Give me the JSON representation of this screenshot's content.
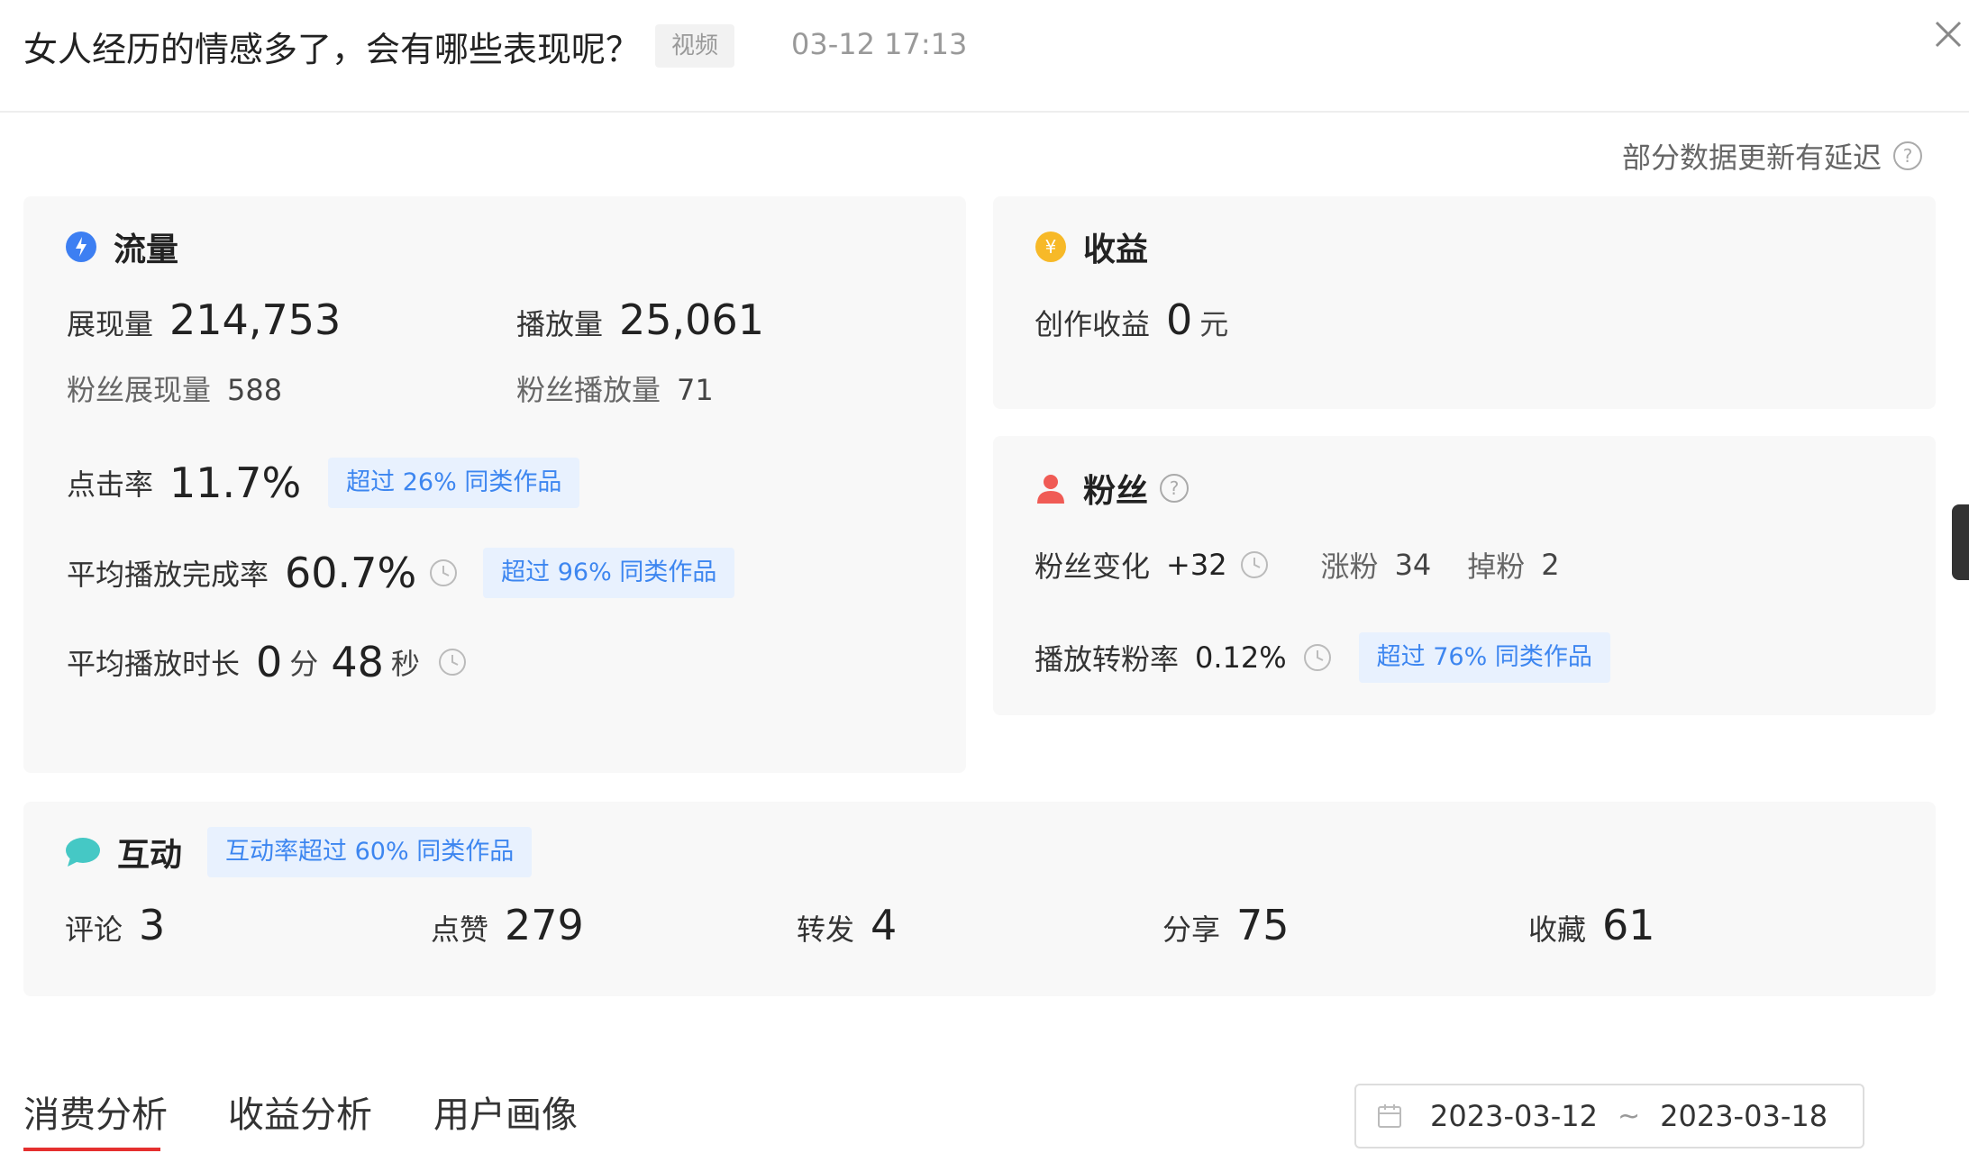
{
  "header": {
    "title": "女人经历的情感多了，会有哪些表现呢？",
    "type_tag": "视频",
    "datetime": "03-12 17:13",
    "close_icon": "close-icon"
  },
  "notice": "部分数据更新有延迟",
  "traffic": {
    "title": "流量",
    "icon": "drop-icon",
    "impressions_label": "展现量",
    "impressions_value": "214,753",
    "plays_label": "播放量",
    "plays_value": "25,061",
    "fan_impressions_label": "粉丝展现量",
    "fan_impressions_value": "588",
    "fan_plays_label": "粉丝播放量",
    "fan_plays_value": "71",
    "ctr_label": "点击率",
    "ctr_value": "11.7%",
    "ctr_badge": "超过 26% 同类作品",
    "completion_label": "平均播放完成率",
    "completion_value": "60.7%",
    "completion_badge": "超过 96% 同类作品",
    "duration_label": "平均播放时长",
    "duration_min": "0",
    "duration_min_unit": "分",
    "duration_sec": "48",
    "duration_sec_unit": "秒"
  },
  "income": {
    "title": "收益",
    "icon": "coin-icon",
    "creation_label": "创作收益",
    "creation_value": "0",
    "creation_unit": "元"
  },
  "fans": {
    "title": "粉丝",
    "icon": "user-icon",
    "change_label": "粉丝变化",
    "change_value": "+32",
    "gain_label": "涨粉",
    "gain_value": "34",
    "loss_label": "掉粉",
    "loss_value": "2",
    "conversion_label": "播放转粉率",
    "conversion_value": "0.12%",
    "conversion_badge": "超过 76% 同类作品"
  },
  "interaction": {
    "title": "互动",
    "icon": "chat-bubble-icon",
    "badge": "互动率超过 60% 同类作品",
    "items": [
      {
        "label": "评论",
        "value": "3"
      },
      {
        "label": "点赞",
        "value": "279"
      },
      {
        "label": "转发",
        "value": "4"
      },
      {
        "label": "分享",
        "value": "75"
      },
      {
        "label": "收藏",
        "value": "61"
      }
    ]
  },
  "tabs": [
    {
      "label": "消费分析",
      "active": true
    },
    {
      "label": "收益分析",
      "active": false
    },
    {
      "label": "用户画像",
      "active": false
    }
  ],
  "date_range": {
    "start": "2023-03-12",
    "separator": "~",
    "end": "2023-03-18",
    "icon": "calendar-icon"
  },
  "colors": {
    "accent_red": "#e5302f",
    "badge_blue": "#3d86f0",
    "badge_bg": "#e8f1fe",
    "traffic_icon": "#3d7ff2",
    "income_icon": "#f7b928",
    "fans_icon": "#f05b55",
    "interaction_icon": "#45c8c5"
  }
}
